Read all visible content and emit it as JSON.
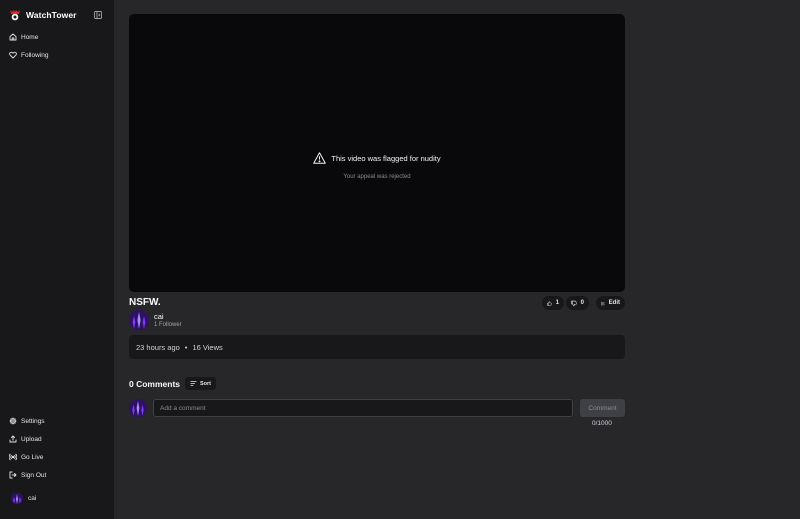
{
  "app": {
    "name": "WatchTower"
  },
  "sidebar": {
    "nav": [
      {
        "label": "Home",
        "icon": "home-icon"
      },
      {
        "label": "Following",
        "icon": "heart-icon"
      }
    ],
    "bottom": [
      {
        "label": "Settings",
        "icon": "gear-icon"
      },
      {
        "label": "Upload",
        "icon": "upload-icon"
      },
      {
        "label": "Go Live",
        "icon": "broadcast-icon"
      },
      {
        "label": "Sign Out",
        "icon": "sign-out-icon"
      }
    ],
    "user": {
      "name": "cai"
    }
  },
  "video": {
    "flag_message": "This video was flagged for nudity",
    "appeal_status": "Your appeal was rejected",
    "title": "NSFW.",
    "likes": "1",
    "dislikes": "0",
    "edit_label": "Edit",
    "posted": "23 hours ago",
    "separator": "•",
    "views": "16 Views"
  },
  "channel": {
    "name": "cai",
    "followers": "1 Follower"
  },
  "comments": {
    "count_label": "0 Comments",
    "sort_label": "Sort",
    "input_placeholder": "Add a comment",
    "submit_label": "Comment",
    "char_count": "0/1000"
  },
  "colors": {
    "background": "#27272a",
    "sidebar": "#18181b",
    "video_bg": "#09090b",
    "brand_accent": "#dc2626",
    "avatar_accent": "#7c3aed"
  }
}
